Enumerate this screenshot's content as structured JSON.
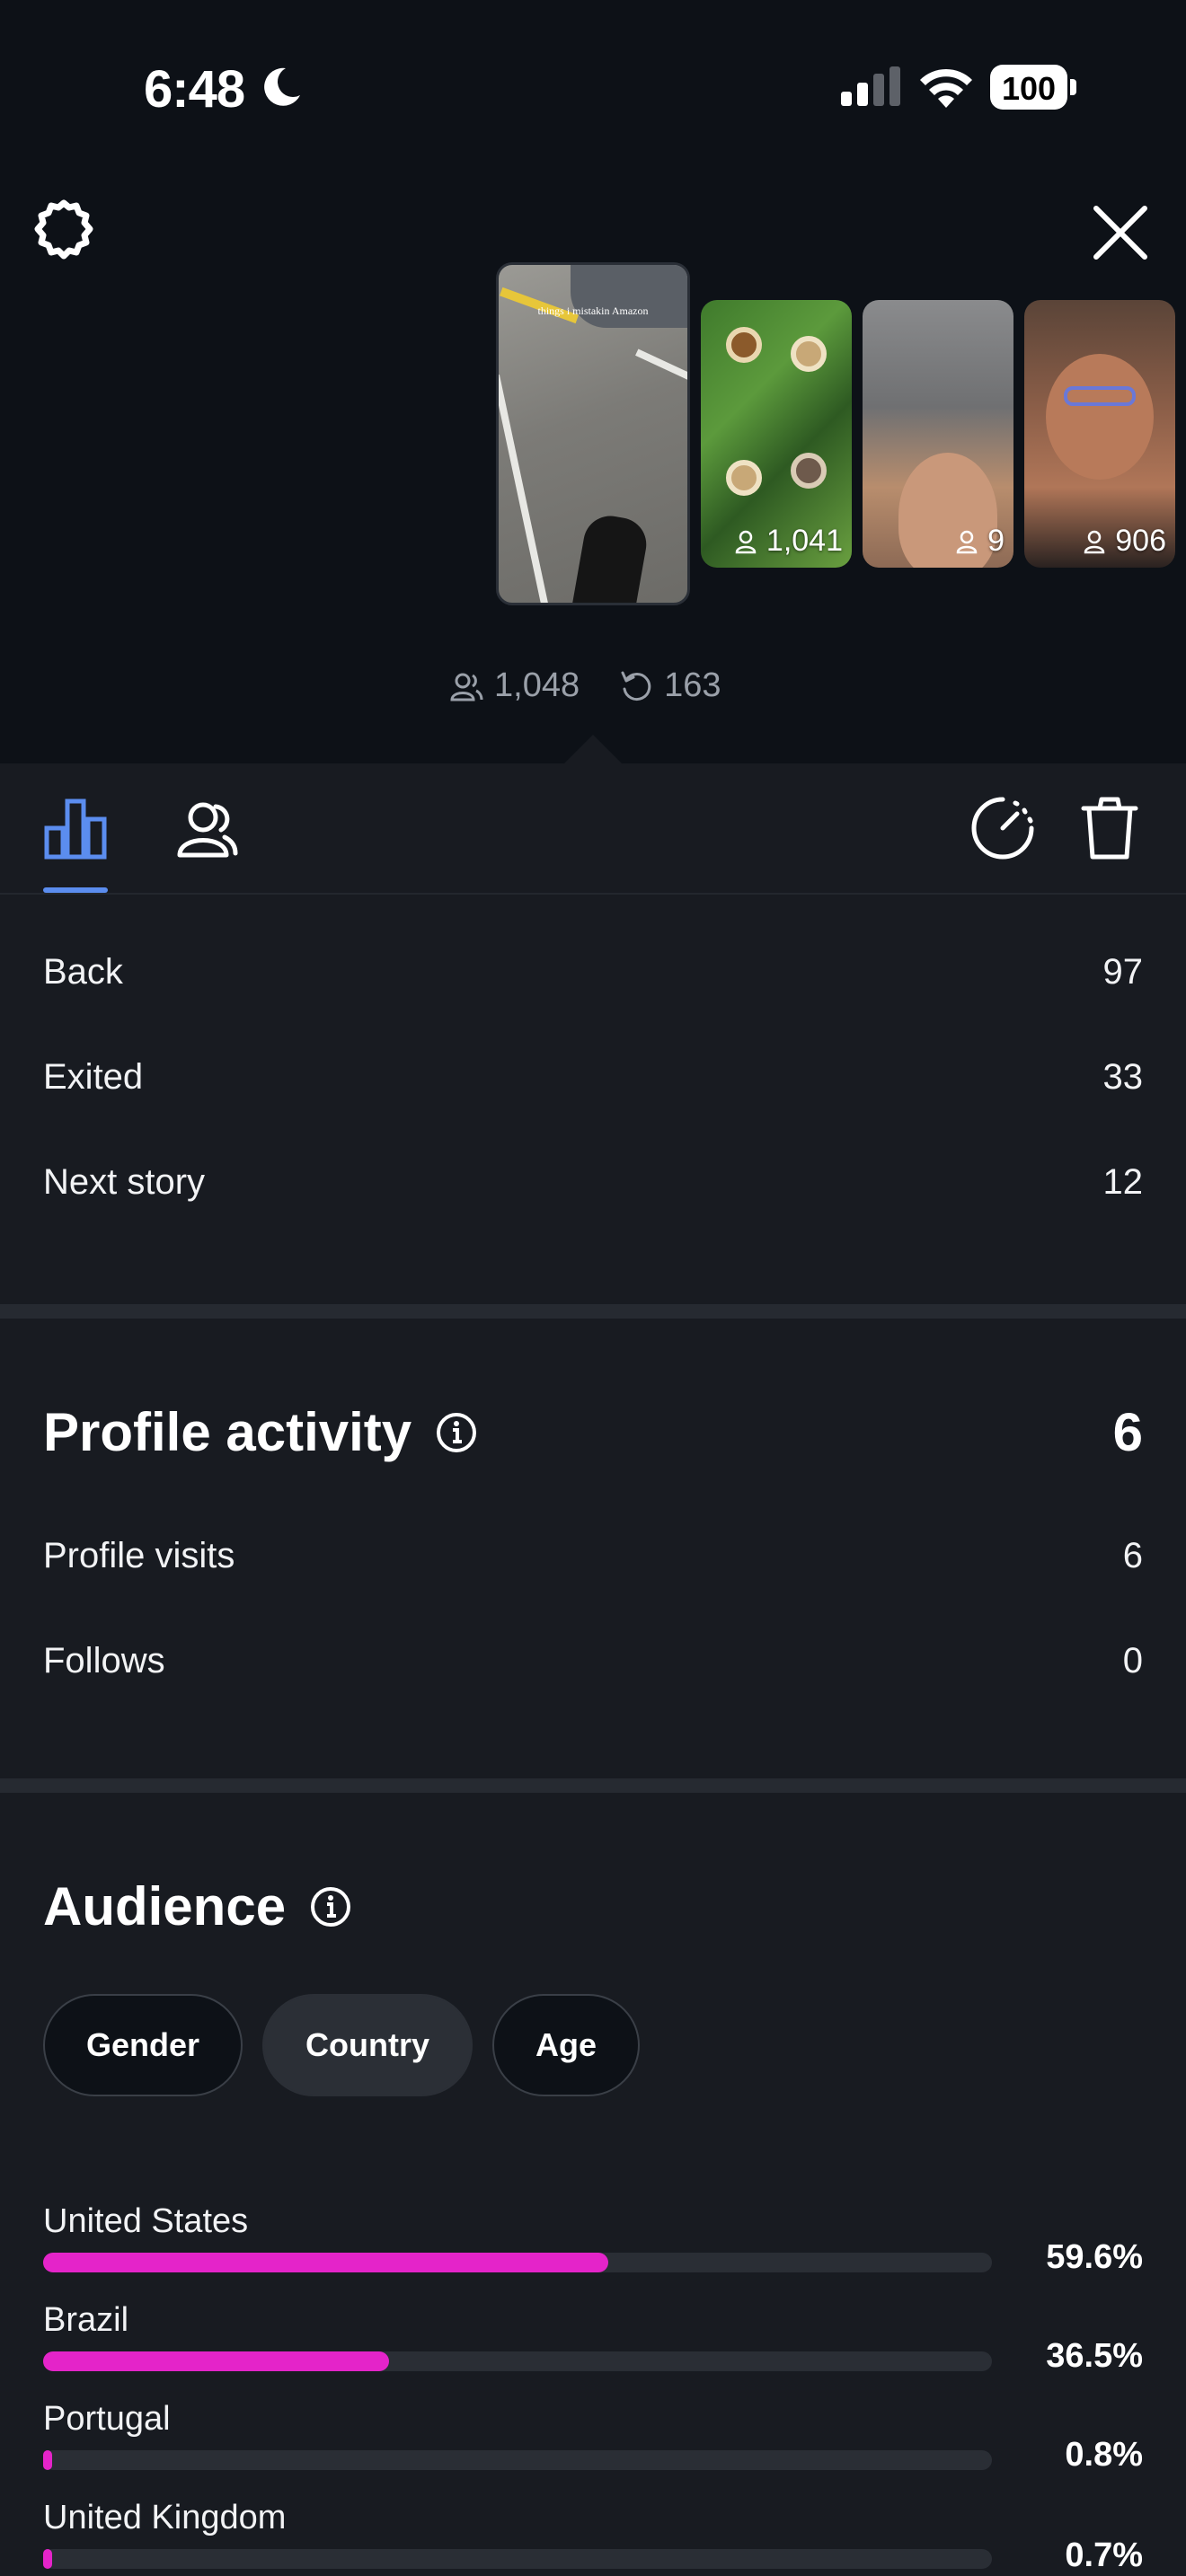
{
  "status_bar": {
    "time": "6:48",
    "battery": "100"
  },
  "stories": [
    {
      "caption": "things i mistakin Amazon",
      "count": ""
    },
    {
      "caption": "",
      "count": "1,041"
    },
    {
      "caption": "",
      "count": "9"
    },
    {
      "caption": "",
      "count": "906"
    }
  ],
  "summary": {
    "viewers": "1,048",
    "replays": "163"
  },
  "navigation": [
    {
      "label": "Back",
      "value": "97"
    },
    {
      "label": "Exited",
      "value": "33"
    },
    {
      "label": "Next story",
      "value": "12"
    }
  ],
  "profile_activity": {
    "title": "Profile activity",
    "total": "6",
    "rows": [
      {
        "label": "Profile visits",
        "value": "6"
      },
      {
        "label": "Follows",
        "value": "0"
      }
    ]
  },
  "audience": {
    "title": "Audience",
    "chips": [
      "Gender",
      "Country",
      "Age"
    ],
    "active_chip": "Country",
    "countries": [
      {
        "name": "United States",
        "pct": "59.6%",
        "fraction": 0.596
      },
      {
        "name": "Brazil",
        "pct": "36.5%",
        "fraction": 0.365
      },
      {
        "name": "Portugal",
        "pct": "0.8%",
        "fraction": 0.008
      },
      {
        "name": "United Kingdom",
        "pct": "0.7%",
        "fraction": 0.007
      }
    ]
  },
  "colors": {
    "accent": "#5b8def",
    "bar": "#e424c9"
  }
}
